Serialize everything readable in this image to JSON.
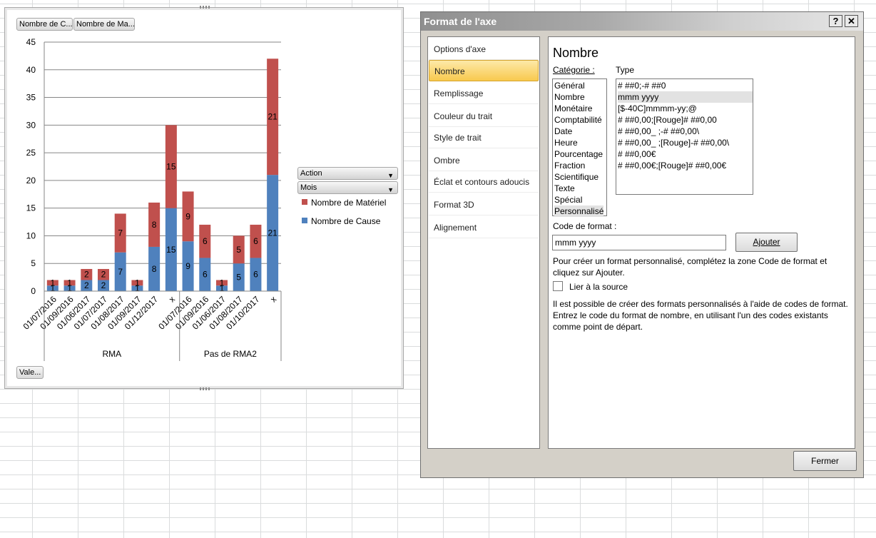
{
  "chart": {
    "field_buttons": [
      "Nombre de C...",
      "Nombre de Ma...",
      "Vale..."
    ],
    "filters": [
      "Action",
      "Mois"
    ],
    "colors": {
      "materiel": "#c0504d",
      "cause": "#4f81bd"
    }
  },
  "chart_data": {
    "type": "bar",
    "stacked": true,
    "categories": [
      "01/07/2016",
      "01/09/2016",
      "01/06/2017",
      "01/07/2017",
      "01/08/2017",
      "01/09/2017",
      "01/12/2017",
      "x",
      "01/07/2016",
      "01/09/2016",
      "01/06/2017",
      "01/08/2017",
      "01/10/2017",
      "x"
    ],
    "groups": [
      {
        "label": "RMA",
        "count": 8
      },
      {
        "label": "Pas de RMA2",
        "count": 6
      }
    ],
    "series": [
      {
        "name": "Nombre de Cause",
        "values": [
          1,
          1,
          2,
          2,
          7,
          1,
          8,
          15,
          9,
          6,
          1,
          5,
          6,
          21
        ]
      },
      {
        "name": "Nombre de Matériel",
        "values": [
          1,
          1,
          2,
          2,
          7,
          1,
          8,
          15,
          9,
          6,
          1,
          5,
          6,
          21
        ]
      }
    ],
    "ylim": [
      0,
      45
    ],
    "yticks": [
      0,
      5,
      10,
      15,
      20,
      25,
      30,
      35,
      40,
      45
    ],
    "grid": true,
    "legend": "right"
  },
  "dialog": {
    "title": "Format de l'axe",
    "help": "?",
    "close": "✕",
    "nav": [
      "Options d'axe",
      "Nombre",
      "Remplissage",
      "Couleur du trait",
      "Style de trait",
      "Ombre",
      "Éclat et contours adoucis",
      "Format 3D",
      "Alignement"
    ],
    "selected_nav": "Nombre",
    "section_title": "Nombre",
    "category_label": "Catégorie :",
    "type_label": "Type",
    "categories": [
      "Général",
      "Nombre",
      "Monétaire",
      "Comptabilité",
      "Date",
      "Heure",
      "Pourcentage",
      "Fraction",
      "Scientifique",
      "Texte",
      "Spécial",
      "Personnalisé"
    ],
    "types": [
      "# ##0;-# ##0",
      "mmm yyyy",
      "[$-40C]mmmm-yy;@",
      "# ##0,00;[Rouge]# ##0,00",
      "# ##0,00_ ;-# ##0,00\\",
      "# ##0,00_ ;[Rouge]-# ##0,00\\",
      "# ##0,00€",
      "# ##0,00€;[Rouge]# ##0,00€"
    ],
    "code_label": "Code de format :",
    "code_value": "mmm yyyy",
    "add_button": "Ajouter",
    "hint": "Pour créer un format personnalisé, complétez la zone Code de format et cliquez sur Ajouter.",
    "link_label": "Lier à la source",
    "info": "Il est possible de créer des formats personnalisés à l'aide de codes de format. Entrez le code du format de nombre, en utilisant l'un des codes existants comme point de départ.",
    "close_button": "Fermer"
  }
}
